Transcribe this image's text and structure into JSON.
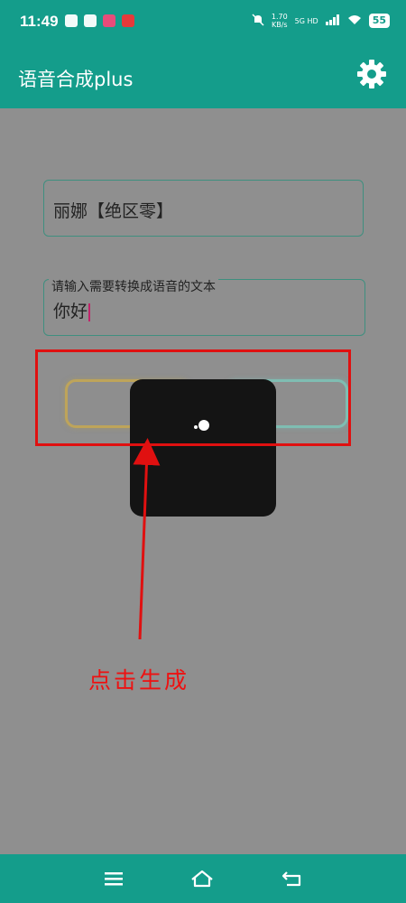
{
  "status_bar": {
    "time": "11:49",
    "speed_value": "1.70",
    "speed_unit": "KB/s",
    "network": "5G HD",
    "battery": "55"
  },
  "app_bar": {
    "title": "语音合成plus",
    "settings_icon": "gear-icon"
  },
  "form": {
    "voice_select_value": "丽娜【绝区零】",
    "text_input_label": "请输入需要转换成语音的文本",
    "text_input_value": "你好"
  },
  "annotation": {
    "text": "点击生成",
    "color": "#e01010"
  },
  "colors": {
    "primary": "#149d8b",
    "overlay": "#8f8f8f",
    "dialog": "#141414",
    "left_button_border": "#bea45a",
    "right_button_border": "#7fbdb2"
  },
  "nav_bar": {
    "icons": [
      "menu-icon",
      "home-icon",
      "back-icon"
    ]
  }
}
